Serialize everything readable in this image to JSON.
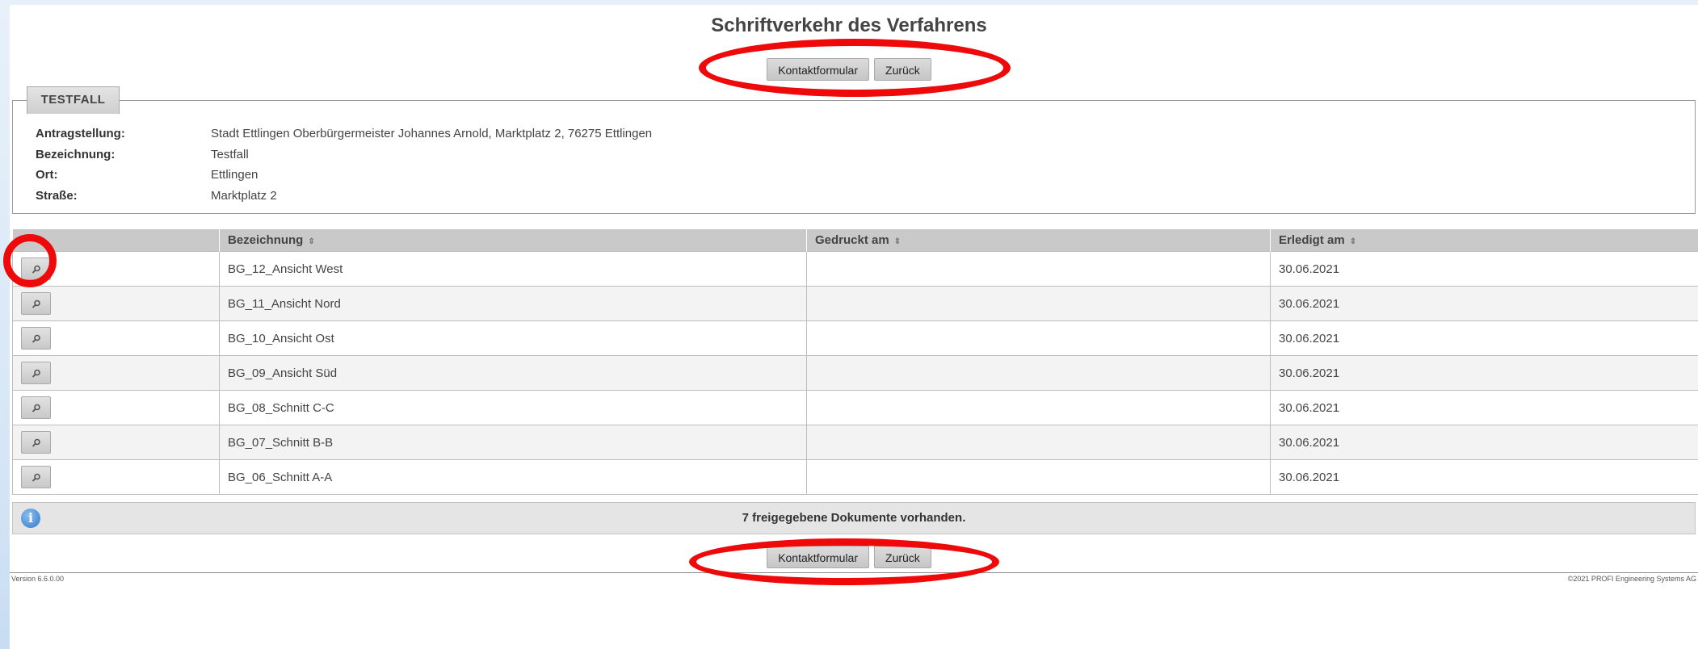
{
  "page": {
    "title": "Schriftverkehr des Verfahrens"
  },
  "actions": {
    "kontakt_label": "Kontaktformular",
    "zurueck_label": "Zurück"
  },
  "case": {
    "legend": "TESTFALL",
    "fields": [
      {
        "label": "Antragstellung:",
        "value": "Stadt Ettlingen Oberbürgermeister Johannes Arnold, Marktplatz 2, 76275 Ettlingen"
      },
      {
        "label": "Bezeichnung:",
        "value": "Testfall"
      },
      {
        "label": "Ort:",
        "value": "Ettlingen"
      },
      {
        "label": "Straße:",
        "value": "Marktplatz 2"
      }
    ]
  },
  "table": {
    "columns": [
      "",
      "Bezeichnung",
      "Gedruckt am",
      "Erledigt am"
    ],
    "sort_icon": "⇕",
    "rows": [
      {
        "bezeichnung": "BG_12_Ansicht West",
        "gedruckt": "",
        "erledigt": "30.06.2021"
      },
      {
        "bezeichnung": "BG_11_Ansicht Nord",
        "gedruckt": "",
        "erledigt": "30.06.2021"
      },
      {
        "bezeichnung": "BG_10_Ansicht Ost",
        "gedruckt": "",
        "erledigt": "30.06.2021"
      },
      {
        "bezeichnung": "BG_09_Ansicht Süd",
        "gedruckt": "",
        "erledigt": "30.06.2021"
      },
      {
        "bezeichnung": "BG_08_Schnitt C-C",
        "gedruckt": "",
        "erledigt": "30.06.2021"
      },
      {
        "bezeichnung": "BG_07_Schnitt B-B",
        "gedruckt": "",
        "erledigt": "30.06.2021"
      },
      {
        "bezeichnung": "BG_06_Schnitt A-A",
        "gedruckt": "",
        "erledigt": "30.06.2021"
      }
    ]
  },
  "info": {
    "icon": "i",
    "message": "7 freigegebene Dokumente vorhanden."
  },
  "footer": {
    "version": "Version 6.6.0.00",
    "copyright": "©2021 PROFI Engineering Systems AG"
  },
  "colors": {
    "highlight": "#ee0a0a",
    "header_bg": "#c9c9c9",
    "info_blue": "#2e77c8"
  }
}
